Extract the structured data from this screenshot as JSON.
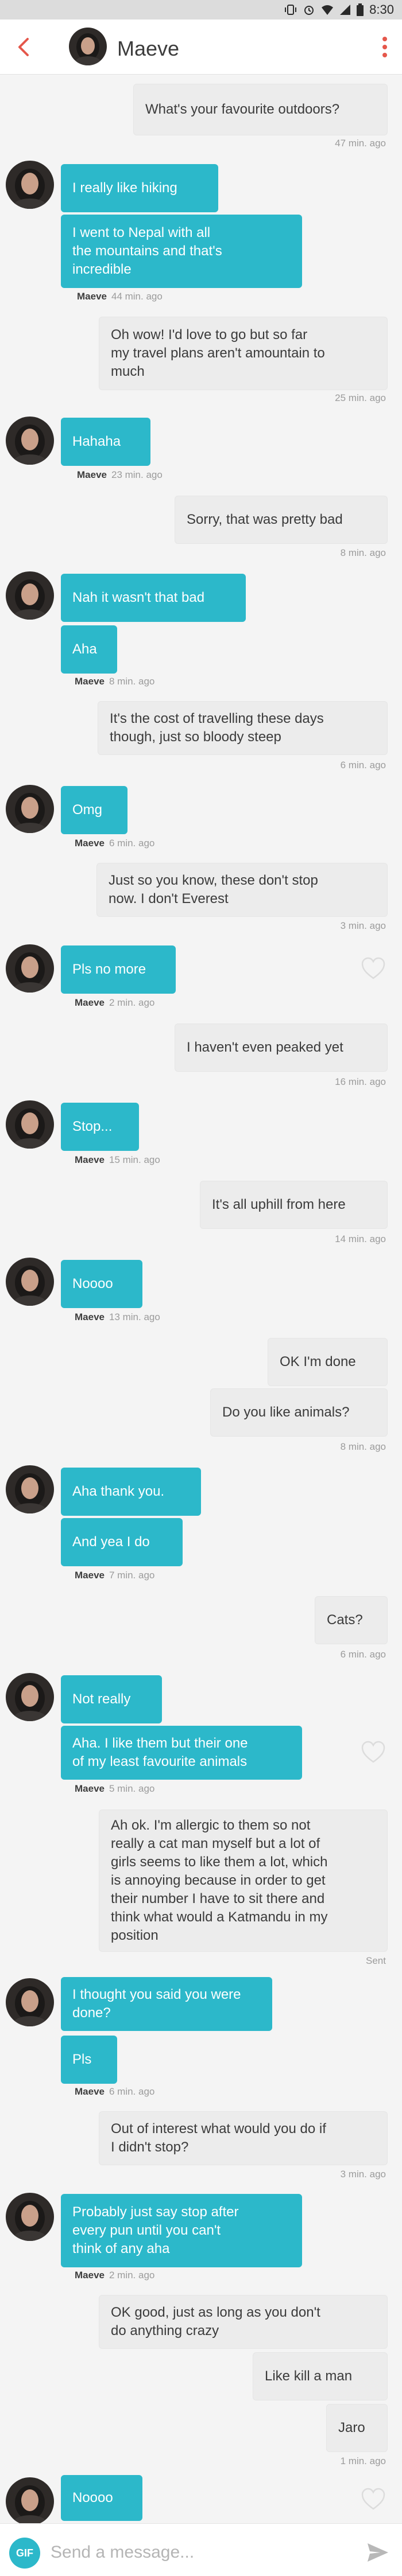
{
  "status_bar": {
    "time": "8:30"
  },
  "header": {
    "name": "Maeve"
  },
  "colors": {
    "accent": "#2cb8ca",
    "back_arrow": "#e5574b",
    "more_dots": "#e5574b"
  },
  "messages": [
    {
      "from": "me",
      "text": "What's your favourite outdoors?",
      "time": "47 min. ago"
    },
    {
      "from": "Maeve",
      "text": "I really like hiking"
    },
    {
      "from": "Maeve",
      "text": "I went to Nepal with all\nthe mountains and that's\nincredible",
      "time": "44 min. ago"
    },
    {
      "from": "me",
      "text": "Oh wow! I'd love to go but so far\nmy travel plans aren't amountain to\nmuch",
      "time": "25 min. ago"
    },
    {
      "from": "Maeve",
      "text": "Hahaha",
      "time": "23 min. ago"
    },
    {
      "from": "me",
      "text": "Sorry, that was pretty bad",
      "time": "8 min. ago"
    },
    {
      "from": "Maeve",
      "text": "Nah it wasn't that bad"
    },
    {
      "from": "Maeve",
      "text": "Aha",
      "time": "8 min. ago"
    },
    {
      "from": "me",
      "text": "It's the cost of travelling these days\nthough, just so bloody steep",
      "time": "6 min. ago"
    },
    {
      "from": "Maeve",
      "text": "Omg",
      "time": "6 min. ago"
    },
    {
      "from": "me",
      "text": "Just so you know, these don't stop\nnow. I don't Everest",
      "time": "3 min. ago"
    },
    {
      "from": "Maeve",
      "text": "Pls no more",
      "time": "2 min. ago"
    },
    {
      "from": "me",
      "text": "I haven't even peaked yet",
      "time": "16 min. ago"
    },
    {
      "from": "Maeve",
      "text": "Stop...",
      "time": "15 min. ago"
    },
    {
      "from": "me",
      "text": "It's all uphill from here",
      "time": "14 min. ago"
    },
    {
      "from": "Maeve",
      "text": "Noooo",
      "time": "13 min. ago"
    },
    {
      "from": "me",
      "text": "OK I'm done"
    },
    {
      "from": "me",
      "text": "Do you like animals?",
      "time": "8 min. ago"
    },
    {
      "from": "Maeve",
      "text": "Aha thank you."
    },
    {
      "from": "Maeve",
      "text": "And yea I do",
      "time": "7 min. ago"
    },
    {
      "from": "me",
      "text": "Cats?",
      "time": "6 min. ago"
    },
    {
      "from": "Maeve",
      "text": "Not really"
    },
    {
      "from": "Maeve",
      "text": "Aha. I like them but their one\nof my least favourite animals",
      "time": "5 min. ago"
    },
    {
      "from": "me",
      "text": "Ah ok. I'm allergic to them so not\nreally a cat man myself but a lot of\ngirls seems to like them a lot, which\nis annoying because in order to get\ntheir number I have to sit there and\nthink what would a Katmandu in my\nposition",
      "time": "Sent"
    },
    {
      "from": "Maeve",
      "text": "I thought you said you were\ndone?"
    },
    {
      "from": "Maeve",
      "text": "Pls",
      "time": "6 min. ago"
    },
    {
      "from": "me",
      "text": "Out of interest what would you do if\nI didn't stop?",
      "time": "3 min. ago"
    },
    {
      "from": "Maeve",
      "text": "Probably just say stop after\nevery pun until you can't\nthink of any aha",
      "time": "2 min. ago"
    },
    {
      "from": "me",
      "text": "OK good, just as long as you don't\ndo anything crazy"
    },
    {
      "from": "me",
      "text": "Like kill a man"
    },
    {
      "from": "me",
      "text": "Jaro",
      "time": "1 min. ago"
    },
    {
      "from": "Maeve",
      "text": "Noooo"
    }
  ],
  "composer": {
    "gif_label": "GIF",
    "placeholder": "Send a message..."
  }
}
